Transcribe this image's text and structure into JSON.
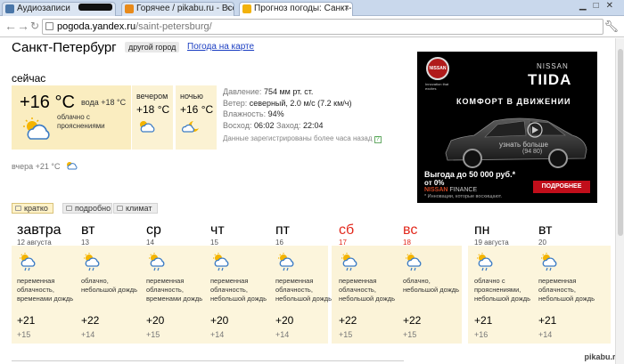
{
  "browser": {
    "tabs": [
      {
        "label": "Аудиозаписи",
        "active": false,
        "icon_color": "#4a76a8"
      },
      {
        "label": "Горячее / pikabu.ru - Все",
        "active": false,
        "icon_color": "#e88a1a"
      },
      {
        "label": "Прогноз погоды: Санкт-П",
        "active": true,
        "icon_color": "#f2b20c"
      }
    ],
    "url_host": "pogoda.yandex.ru",
    "url_path": "/saint-petersburg/"
  },
  "header": {
    "city": "Санкт-Петербург",
    "other_city": "другой город",
    "map_link": "Погода на карте"
  },
  "now": {
    "label": "сейчас",
    "temp": "+16 °C",
    "water": "вода +18 °C",
    "condition": "облачно с прояснениями",
    "icon": "partly-cloudy-icon"
  },
  "parts": [
    {
      "label": "вечером",
      "temp": "+18 °C",
      "icon": "partly-cloudy-icon"
    },
    {
      "label": "ночью",
      "temp": "+16 °C",
      "icon": "moon-cloud-icon"
    }
  ],
  "details": {
    "pressure_label": "Давление:",
    "pressure": "754 мм рт. ст.",
    "wind_label": "Ветер:",
    "wind": "северный, 2.0 м/с (7.2 км/ч)",
    "humidity_label": "Влажность:",
    "humidity": "94%",
    "sunrise_label": "Восход:",
    "sunrise": "06:02",
    "sunset_label": "Заход:",
    "sunset": "22:04",
    "note": "Данные зарегистрированы более часа назад"
  },
  "yesterday": "вчера +21 °C",
  "ad": {
    "brand": "NISSAN",
    "model": "TIIDA",
    "logo_text": "NISSAN",
    "slogan": "Innovation that excites",
    "tagline": "КОМФОРТ В ДВИЖЕНИИ",
    "learn_more": "узнать больше",
    "learn_more_2": "(94 80)",
    "benefit_line1": "Выгода до 50 000 руб.*",
    "benefit_line2": "от 0%",
    "finance_brand": "NISSAN",
    "finance_word": "FINANCE",
    "fine_print": "* Инновации, которые восхищают.",
    "button": "ПОДРОБНЕЕ"
  },
  "forecast_tabs": [
    {
      "label": "кратко",
      "active": true
    },
    {
      "label": "подробно",
      "active": false
    },
    {
      "label": "климат",
      "active": false
    }
  ],
  "forecast": [
    {
      "day": "завтра",
      "date": "12 августа",
      "cond": "переменная облачность, временами дождь",
      "hi": "+21",
      "lo": "+15",
      "weekend": false
    },
    {
      "day": "вт",
      "date": "13",
      "cond": "облачно, небольшой дождь",
      "hi": "+22",
      "lo": "+14",
      "weekend": false
    },
    {
      "day": "ср",
      "date": "14",
      "cond": "переменная облачность, временами дождь",
      "hi": "+20",
      "lo": "+15",
      "weekend": false
    },
    {
      "day": "чт",
      "date": "15",
      "cond": "переменная облачность, небольшой дождь",
      "hi": "+20",
      "lo": "+14",
      "weekend": false
    },
    {
      "day": "пт",
      "date": "16",
      "cond": "переменная облачность, небольшой дождь",
      "hi": "+20",
      "lo": "+14",
      "weekend": false
    },
    {
      "day": "сб",
      "date": "17",
      "cond": "переменная облачность, небольшой дождь",
      "hi": "+22",
      "lo": "+15",
      "weekend": true
    },
    {
      "day": "вс",
      "date": "18",
      "cond": "облачно, небольшой дождь",
      "hi": "+22",
      "lo": "+15",
      "weekend": true
    },
    {
      "day": "пн",
      "date": "19 августа",
      "cond": "облачно с прояснениями, небольшой дождь",
      "hi": "+21",
      "lo": "+16",
      "weekend": false
    },
    {
      "day": "вт",
      "date": "20",
      "cond": "переменная облачность, небольшой дождь",
      "hi": "+21",
      "lo": "+14",
      "weekend": false
    }
  ],
  "watermark": "pikabu.ru",
  "colors": {
    "accent_bg": "#faedc0",
    "weekend_red": "#e2281c",
    "link": "#1a3dc1",
    "ad_button": "#c10e1a"
  }
}
